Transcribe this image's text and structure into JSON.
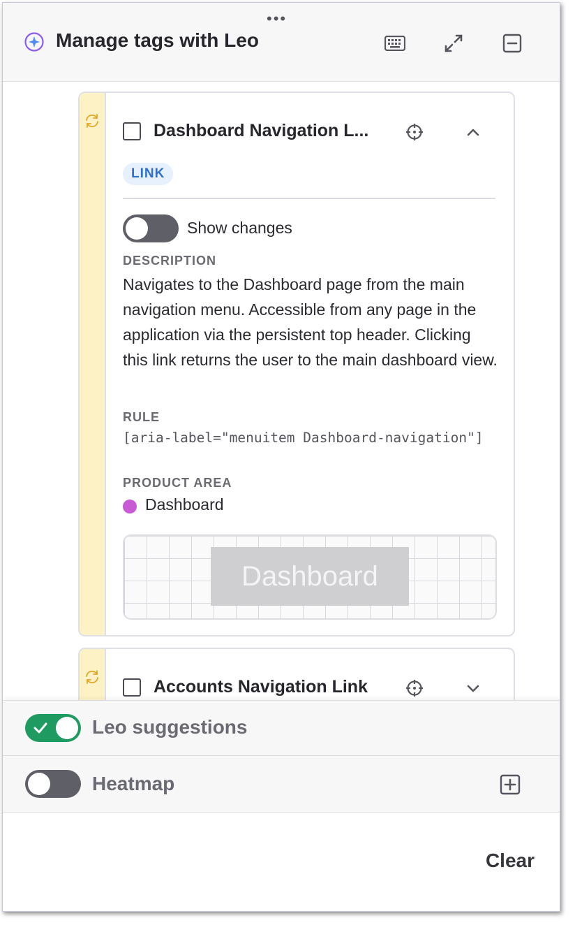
{
  "header": {
    "title": "Manage tags with Leo",
    "icons": [
      "drag-handle-icon",
      "leo-sparkle-icon",
      "keyboard-icon",
      "expand-icon",
      "minimize-icon"
    ]
  },
  "cards": [
    {
      "title": "Dashboard Navigation L...",
      "badge": "LINK",
      "show_changes_label": "Show changes",
      "description_label": "DESCRIPTION",
      "description": "Navigates to the Dashboard page from the main navigation menu. Accessible from any page in the application via the persistent top header. Clicking this link returns the user to the main dashboard view.",
      "rule_label": "RULE",
      "rule": "[aria-label=\"menuitem Dashboard-navigation\"]",
      "product_area_label": "PRODUCT AREA",
      "product_area": "Dashboard",
      "product_area_color": "#c95ad6",
      "preview_text": "Dashboard",
      "expanded": true
    },
    {
      "title": "Accounts Navigation Link",
      "expanded": false
    }
  ],
  "footer": {
    "leo_suggestions_label": "Leo suggestions",
    "leo_suggestions_on": true,
    "heatmap_label": "Heatmap",
    "heatmap_on": false,
    "clear_label": "Clear"
  },
  "colors": {
    "accent_green": "#1f9b62",
    "stripe_yellow": "#fdf2c5",
    "badge_blue": "#2f6fd0"
  }
}
